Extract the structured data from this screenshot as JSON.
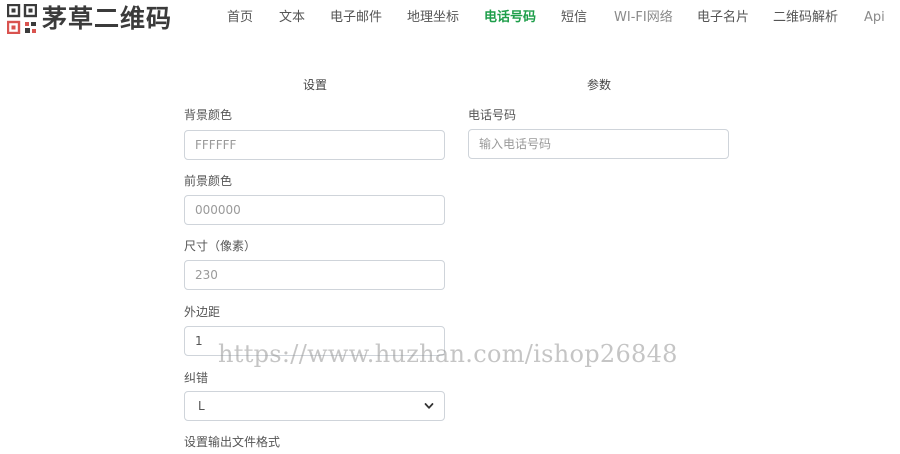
{
  "header": {
    "logo_text": "茅草二维码",
    "nav": [
      {
        "label": "首页"
      },
      {
        "label": "文本"
      },
      {
        "label": "电子邮件"
      },
      {
        "label": "地理坐标"
      },
      {
        "label": "电话号码",
        "active": true
      },
      {
        "label": "短信"
      },
      {
        "label": "WI-FI网络"
      },
      {
        "label": "电子名片"
      },
      {
        "label": "二维码解析"
      },
      {
        "label": "Api"
      }
    ]
  },
  "settings": {
    "heading": "设置",
    "background_color": {
      "label": "背景颜色",
      "placeholder": "FFFFFF"
    },
    "foreground_color": {
      "label": "前景颜色",
      "placeholder": "000000"
    },
    "size": {
      "label": "尺寸（像素）",
      "placeholder": "230"
    },
    "margin": {
      "label": "外边距",
      "value": "1"
    },
    "error_correction": {
      "label": "纠错",
      "value": "L"
    },
    "output_format": {
      "label": "设置输出文件格式"
    }
  },
  "params": {
    "heading": "参数",
    "phone": {
      "label": "电话号码",
      "placeholder": "输入电话号码"
    }
  },
  "watermark": "https://www.huzhan.com/ishop26848",
  "colors": {
    "active_nav": "#1e9e4a",
    "logo_red": "#d9534f",
    "logo_dark": "#3b3b3b"
  }
}
